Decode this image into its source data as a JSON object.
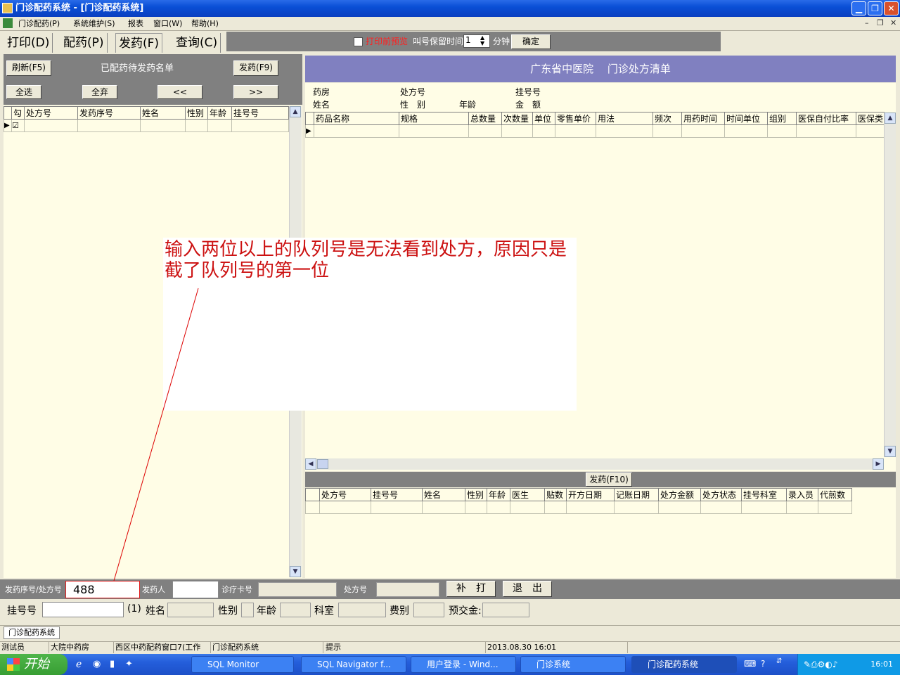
{
  "window": {
    "title": "门诊配药系统 - [门诊配药系统]"
  },
  "menu": [
    "门诊配药(P)",
    "系统维护(S)",
    "报表",
    "窗口(W)",
    "帮助(H)"
  ],
  "tabs": [
    "打印(D)",
    "配药(P)",
    "发药(F)",
    "查询(C)"
  ],
  "toolbar": {
    "preview_label": "打印前预览",
    "keep_label": "叫号保留时间",
    "keep_value": "1",
    "unit": "分钟",
    "ok": "确定"
  },
  "left": {
    "refresh": "刷新(F5)",
    "title": "已配药待发药名单",
    "dispense": "发药(F9)",
    "select_all": "全选",
    "deselect_all": "全弃",
    "prev": "<<",
    "next": ">>",
    "columns": [
      "勾",
      "处方号",
      "发药序号",
      "姓名",
      "性别",
      "年龄",
      "挂号号"
    ]
  },
  "right": {
    "header": "广东省中医院　 门诊处方清单",
    "info": {
      "pharmacy": "药房",
      "rx_no": "处方号",
      "reg_no": "挂号号",
      "name": "姓名",
      "sex": "性　别",
      "age": "年龄",
      "amount": "金　额"
    },
    "drug_columns": [
      "药品名称",
      "规格",
      "总数量",
      "次数量",
      "单位",
      "零售单价",
      "用法",
      "频次",
      "用药时间",
      "时间单位",
      "组别",
      "医保自付比率",
      "医保类"
    ],
    "dispense_btn": "发药(F10)",
    "lower_columns": [
      "处方号",
      "挂号号",
      "姓名",
      "性别",
      "年龄",
      "医生",
      "贴数",
      "开方日期",
      "记账日期",
      "处方金额",
      "处方状态",
      "挂号科室",
      "录入员",
      "代煎数"
    ]
  },
  "bottom": {
    "seq_label": "发药序号/处方号",
    "seq_value": "488",
    "dispenser": "发药人",
    "card": "诊疗卡号",
    "rx": "处方号",
    "reprint": "补　打",
    "exit": "退　出",
    "reg_label": "挂号号",
    "reg_suffix": "(1)",
    "name": "姓名",
    "sex": "性别",
    "age": "年龄",
    "dept": "科室",
    "fee": "费别",
    "prepay": "预交金:"
  },
  "annotation": "输入两位以上的队列号是无法看到处方，原因只是截了队列号的第一位",
  "doc_tab": "门诊配药系统",
  "status": [
    "测试员",
    "大院中药房",
    "西区中药配药窗口7(工作",
    "门诊配药系统",
    "提示",
    "2013.08.30 16:01"
  ],
  "taskbar": {
    "start": "开始",
    "items": [
      "SQL Monitor",
      "SQL Navigator f...",
      "用户登录 - Wind...",
      "门诊系统",
      "门诊配药系统"
    ],
    "clock": "16:01"
  }
}
